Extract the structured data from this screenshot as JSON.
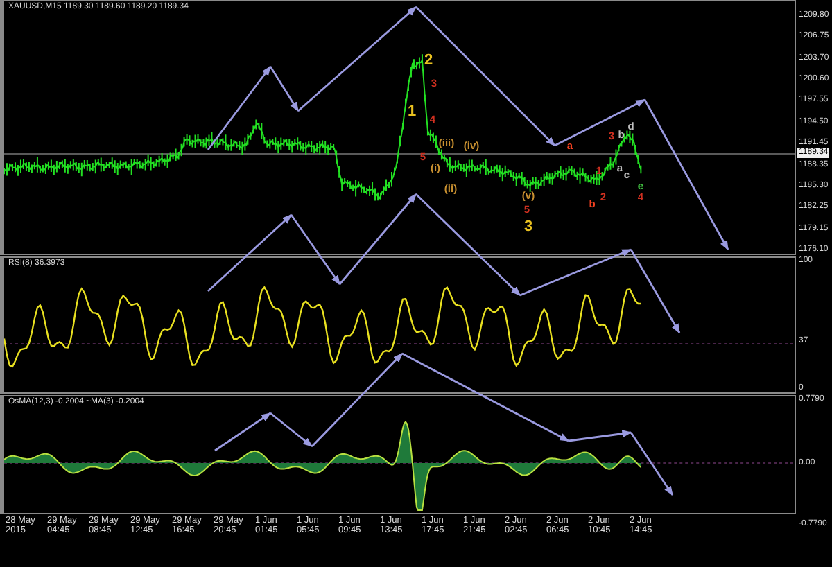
{
  "main": {
    "title": "XAUUSD,M15 1189.30 1189.60 1189.20 1189.34",
    "price_axis": [
      "1209.80",
      "1206.75",
      "1203.70",
      "1200.60",
      "1197.55",
      "1194.50",
      "1191.45",
      "1188.35",
      "1185.30",
      "1182.25",
      "1179.15",
      "1176.10"
    ],
    "current_price": "1189.34"
  },
  "rsi": {
    "label": "RSI(8) 36.3973",
    "axis": [
      "100",
      "37",
      "0"
    ]
  },
  "osma": {
    "label": "OsMA(12,3) -0.2004 ~MA(3) -0.2004",
    "axis": [
      "0.7790",
      "0.00",
      "-0.7790"
    ]
  },
  "time_axis": [
    "28 May 2015",
    "29 May 04:45",
    "29 May 08:45",
    "29 May 12:45",
    "29 May 16:45",
    "29 May 20:45",
    "1 Jun 01:45",
    "1 Jun 05:45",
    "1 Jun 09:45",
    "1 Jun 13:45",
    "1 Jun 17:45",
    "1 Jun 21:45",
    "2 Jun 02:45",
    "2 Jun 06:45",
    "2 Jun 10:45",
    "2 Jun 14:45"
  ],
  "wave_labels": [
    {
      "text": "2",
      "kind": "major",
      "color": "#e8c020"
    },
    {
      "text": "3",
      "kind": "minor",
      "color": "#d03020"
    },
    {
      "text": "1",
      "kind": "major",
      "color": "#e8c020"
    },
    {
      "text": "4",
      "kind": "minor",
      "color": "#d03020"
    },
    {
      "text": "(iii)",
      "kind": "minor",
      "color": "#c89030"
    },
    {
      "text": "(iv)",
      "kind": "minor",
      "color": "#c89030"
    },
    {
      "text": "5",
      "kind": "minor",
      "color": "#d03020"
    },
    {
      "text": "(i)",
      "kind": "minor",
      "color": "#c89030"
    },
    {
      "text": "(ii)",
      "kind": "minor",
      "color": "#c89030"
    },
    {
      "text": "(v)",
      "kind": "minor",
      "color": "#c89030"
    },
    {
      "text": "5",
      "kind": "minor",
      "color": "#d03020"
    },
    {
      "text": "3",
      "kind": "major",
      "color": "#e8c020"
    },
    {
      "text": "a",
      "kind": "minor",
      "color": "#f04020"
    },
    {
      "text": "3",
      "kind": "minor",
      "color": "#d03020"
    },
    {
      "text": "b",
      "kind": "minor",
      "color": "#c0c0c0"
    },
    {
      "text": "d",
      "kind": "minor",
      "color": "#c0c0c0"
    },
    {
      "text": "1",
      "kind": "minor",
      "color": "#d03020"
    },
    {
      "text": "a",
      "kind": "minor",
      "color": "#c0c0c0"
    },
    {
      "text": "c",
      "kind": "minor",
      "color": "#c0c0c0"
    },
    {
      "text": "2",
      "kind": "minor",
      "color": "#d03020"
    },
    {
      "text": "b",
      "kind": "minor",
      "color": "#f04020"
    },
    {
      "text": "e",
      "kind": "minor",
      "color": "#40c040"
    },
    {
      "text": "4",
      "kind": "minor",
      "color": "#d03020"
    }
  ]
}
